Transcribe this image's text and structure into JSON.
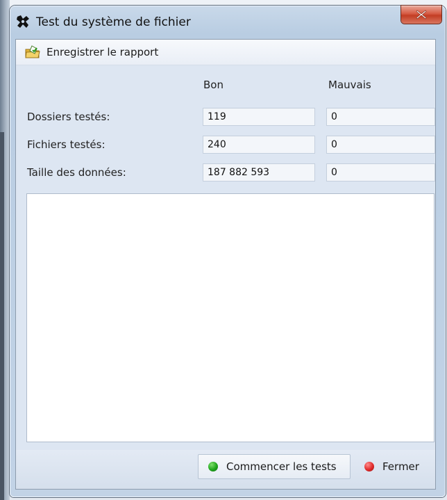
{
  "window": {
    "title": "Test du système de fichier",
    "close_glyph": "X"
  },
  "toolbar": {
    "save_label": "Enregistrer le rapport",
    "save_icon": "save-report-icon"
  },
  "columns": {
    "good": "Bon",
    "bad": "Mauvais"
  },
  "rows": [
    {
      "label": "Dossiers testés:",
      "good": "119",
      "bad": "0"
    },
    {
      "label": "Fichiers testés:",
      "good": "240",
      "bad": "0"
    },
    {
      "label": "Taille des données:",
      "good": "187 882 593",
      "bad": "0"
    }
  ],
  "log": {
    "content": ""
  },
  "footer": {
    "start_label": "Commencer les tests",
    "close_label": "Fermer"
  },
  "colors": {
    "start_dot": "#1fa51c",
    "close_dot": "#e02a2a",
    "close_button": "#c94a31"
  }
}
